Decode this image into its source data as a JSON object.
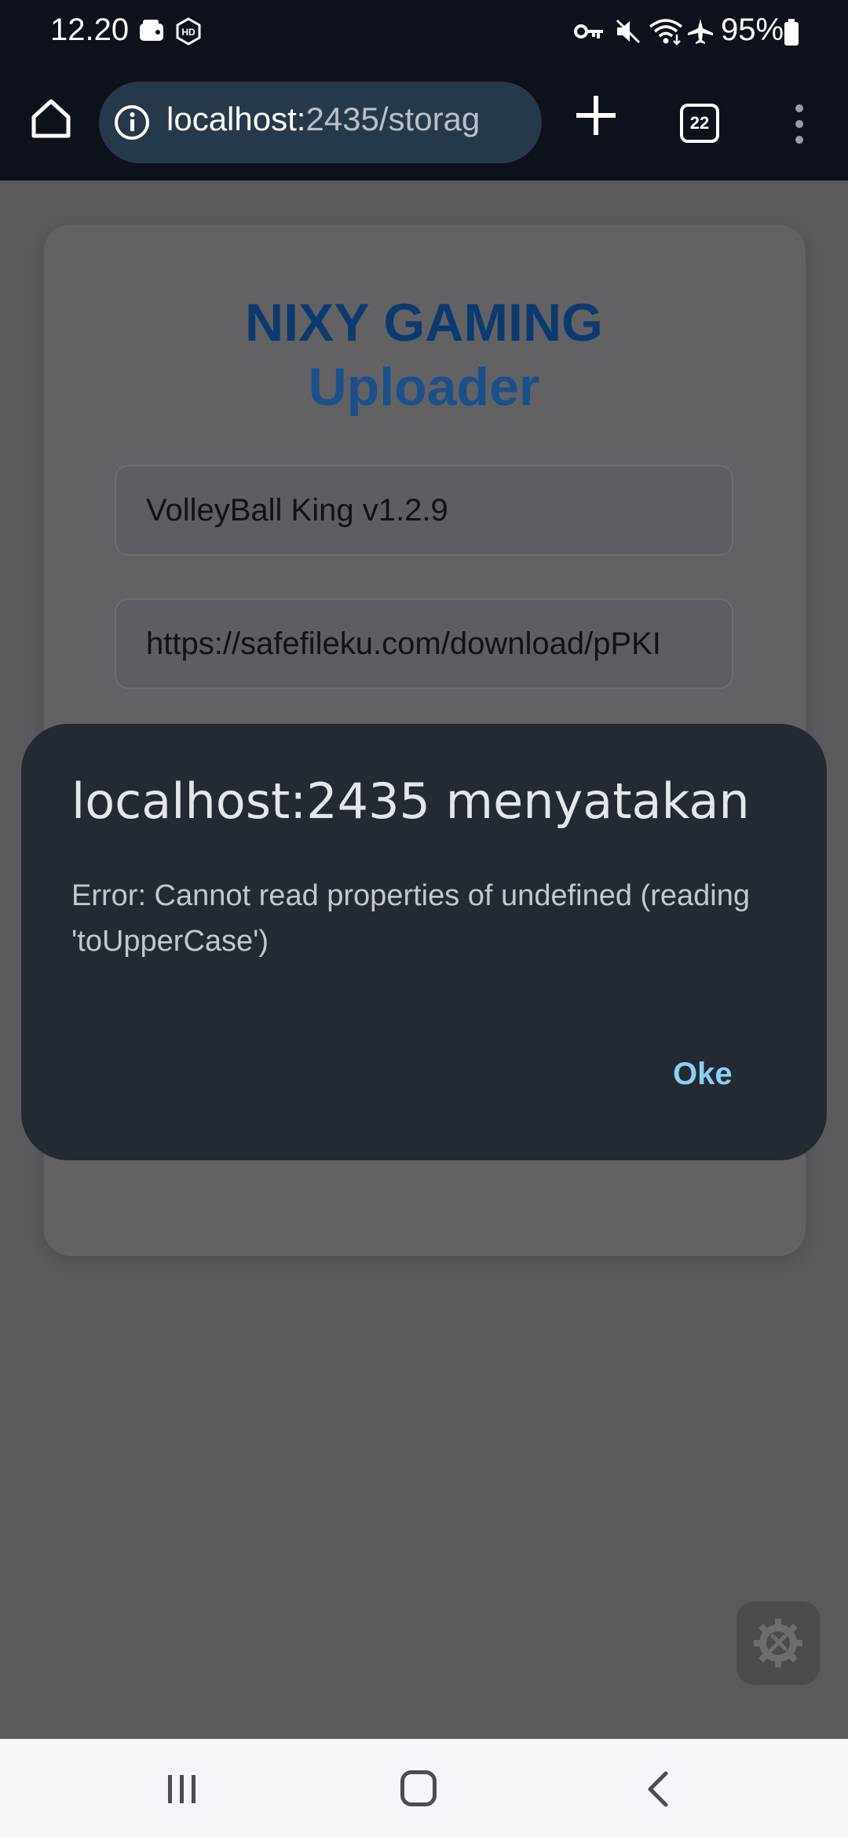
{
  "status_bar": {
    "time": "12.20",
    "battery_percent": "95%",
    "left_icons": [
      "wallet-icon",
      "hd-icon"
    ],
    "right_icons": [
      "vpn-key-icon",
      "mute-icon",
      "wifi-icon",
      "airplane-icon",
      "battery-icon"
    ]
  },
  "browser": {
    "url_host": "localhost:",
    "url_path": "2435/storag",
    "tab_count": "22",
    "icons": [
      "home-icon",
      "site-info-icon",
      "new-tab-icon",
      "tab-switcher-icon",
      "more-menu-icon"
    ]
  },
  "page": {
    "title_line1": "NIXY GAMING",
    "title_line2": "Uploader",
    "field1_value": "VolleyBall King v1.2.9",
    "field2_value": "https://safefileku.com/download/pPKI",
    "colors": {
      "title": "#0d3a6e",
      "title_line2": "#1a4f8a"
    }
  },
  "dialog": {
    "title": "localhost:2435 menyatakan",
    "message": "Error: Cannot read properties of undefined (reading 'toUpperCase')",
    "ok_label": "Oke",
    "colors": {
      "background": "#232a31",
      "ok": "#8ad0f5"
    }
  },
  "nav": {
    "icons": [
      "recent-apps-icon",
      "home-icon",
      "back-icon"
    ]
  }
}
